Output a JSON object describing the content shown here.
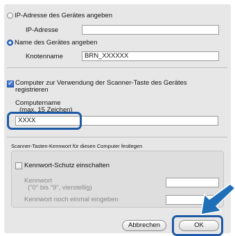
{
  "ip_section": {
    "radio_label": "IP-Adresse des Gerätes angeben",
    "field_label": "IP-Adresse",
    "field_value": ""
  },
  "node_section": {
    "radio_label": "Name des Gerätes angeben",
    "field_label": "Knotenname",
    "field_value": "BRN_XXXXXX"
  },
  "scanner_key": {
    "checkbox_label_line1": "Computer zur Verwendung der Scanner-Taste des Gerätes",
    "checkbox_label_line2": "registrieren",
    "computer_name_label": "Computername",
    "computer_name_hint": "(max. 15 Zeichen)",
    "computer_name_value": "XXXX"
  },
  "password_group": {
    "title": "Scanner-Tasten-Kennwort für diesen Computer festlegen",
    "checkbox_label": "Kennwort-Schutz einschalten",
    "password_label": "Kennwort",
    "password_hint": "(\"0\" bis \"9\", vierstellig)",
    "confirm_label": "Kennwort noch einmal eingeben",
    "password_value": "",
    "confirm_value": ""
  },
  "buttons": {
    "cancel": "Abbrechen",
    "ok": "OK"
  },
  "colors": {
    "accent": "#1d5aa6",
    "arrow": "#1f6fb8"
  }
}
